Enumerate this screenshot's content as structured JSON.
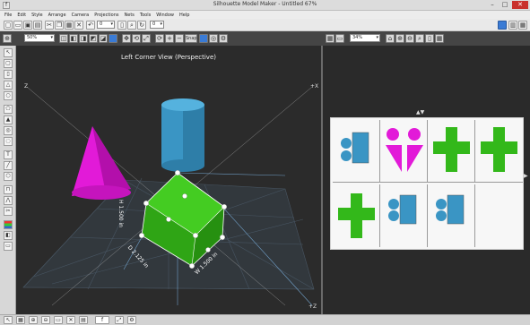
{
  "window": {
    "title": "Silhouette Model Maker - Untitled 67%",
    "app_icon": "app-icon",
    "minimize": "–",
    "maximize": "□",
    "close": "✕"
  },
  "menu": [
    "File",
    "Edit",
    "Style",
    "Arrange",
    "Camera",
    "Projections",
    "Nets",
    "Tools",
    "Window",
    "Help"
  ],
  "toolbar": {
    "zoom_3d": "50%",
    "zoom_2d": "34%",
    "size_value": "0",
    "top_combo": "0",
    "snap_label": "Snap"
  },
  "viewport3d": {
    "title": "Left Corner View (Perspective)",
    "axes": {
      "z_neg": "Z",
      "x_pos": "+X",
      "z_pos": "+Z"
    },
    "dimensions": {
      "height": "H 1.500 in",
      "depth": "D 2.125 in",
      "width": "W 1.500 in"
    },
    "colors": {
      "cone": "#e21ad8",
      "cylinder": "#3a95c4",
      "box": "#33b81a",
      "grid": "#4b5a68"
    }
  },
  "view2d": {
    "pieces": [
      [
        "blue-net",
        "magenta-cone-net",
        "green-cross-net",
        "green-cross-net"
      ],
      [
        "green-cross-net",
        "blue-net",
        "blue-net",
        "empty"
      ]
    ]
  },
  "statusbar": {
    "zoom": "f"
  }
}
